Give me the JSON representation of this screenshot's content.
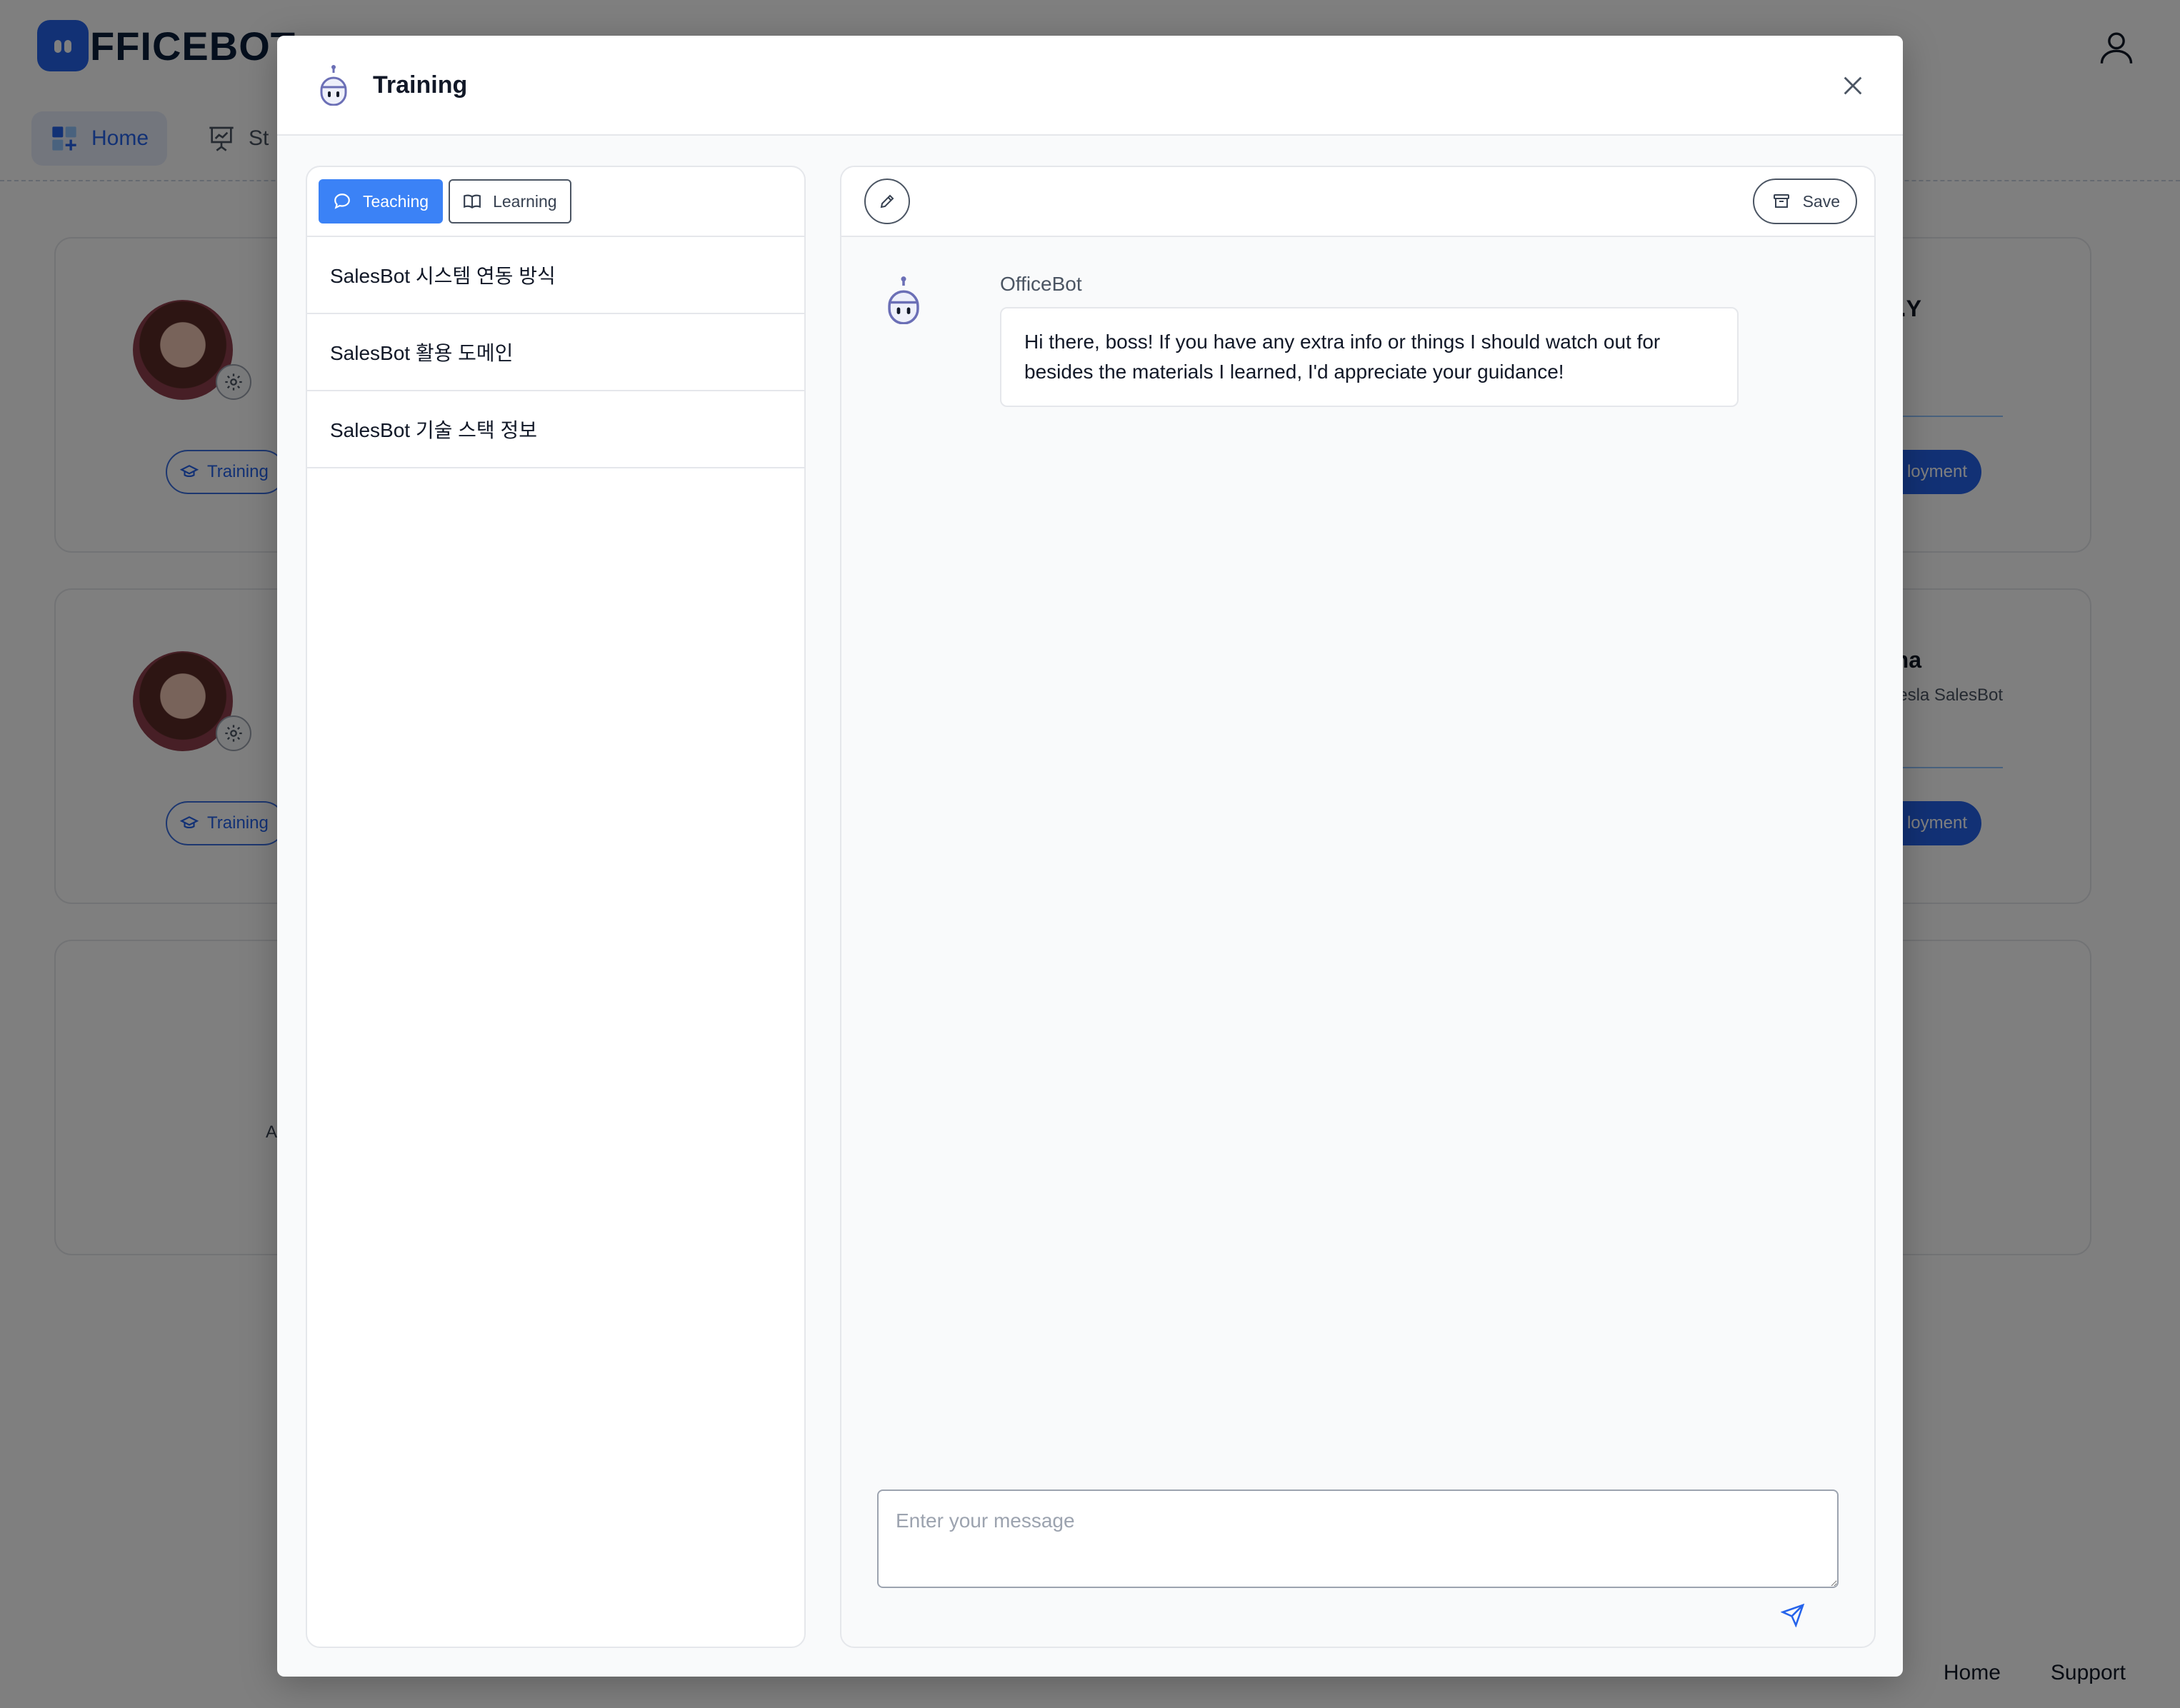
{
  "app": {
    "logo_text": "FFICEBOT",
    "nav": [
      {
        "label": "Home"
      },
      {
        "label": "St"
      }
    ],
    "cards": [
      {
        "training_label": "Training",
        "name": "l.Y",
        "subtitle": "",
        "deploy_label": "loyment"
      },
      {
        "training_label": "Training",
        "name": "lina",
        "subtitle": "esla SalesBot",
        "deploy_label": "loyment"
      },
      {
        "text": "A"
      }
    ],
    "footer": {
      "home": "Home",
      "support": "Support"
    }
  },
  "modal": {
    "title": "Training",
    "tabs": [
      {
        "label": "Teaching",
        "active": true,
        "icon": "chat-bubble-icon"
      },
      {
        "label": "Learning",
        "active": false,
        "icon": "book-icon"
      }
    ],
    "topics": [
      {
        "label": "SalesBot 시스템 연동 방식"
      },
      {
        "label": "SalesBot 활용 도메인"
      },
      {
        "label": "SalesBot 기술 스택 정보"
      }
    ],
    "toolbar": {
      "save_label": "Save"
    },
    "chat": {
      "sender": "OfficeBot",
      "message": "Hi there, boss! If you have any extra info or things I should watch out for besides the materials I learned, I'd appreciate your guidance!"
    },
    "composer": {
      "placeholder": "Enter your message",
      "value": ""
    }
  },
  "colors": {
    "accent": "#3b82f6",
    "brand": "#2563eb",
    "overlay": "rgba(0,0,0,0.5)"
  }
}
